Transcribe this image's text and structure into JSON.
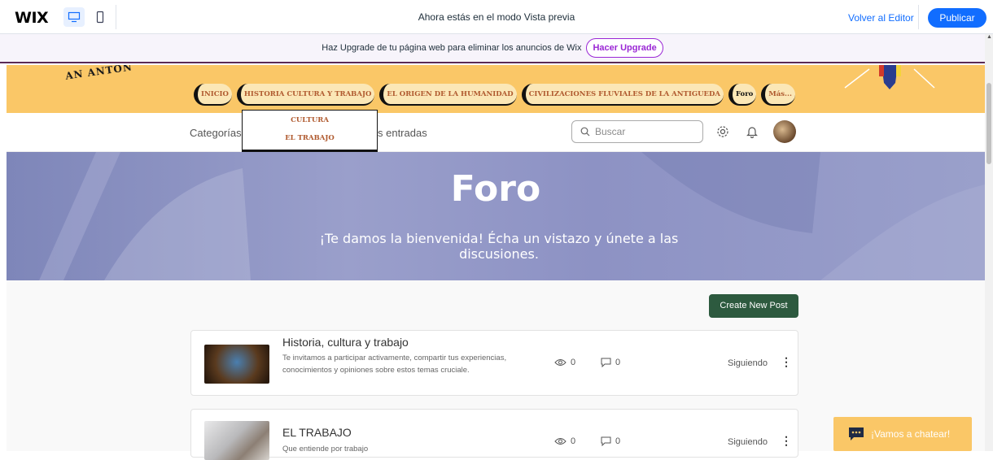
{
  "wix_bar": {
    "logo": "WIX",
    "preview_text": "Ahora estás en el modo Vista previa",
    "back_to_editor": "Volver al Editor",
    "publish": "Publicar",
    "accent_color": "#116dff"
  },
  "upgrade_banner": {
    "text": "Haz Upgrade de tu página web para eliminar los anuncios de Wix",
    "button": "Hacer Upgrade"
  },
  "site_header": {
    "logo_text": "AN ANTON",
    "nav": [
      "INICIO",
      "HISTORIA CULTURA Y TRABAJO",
      "EL ORIGEN DE LA HUMANIDAD",
      "CIVILIZACIONES FLUVIALES DE LA ANTIGUEDA",
      "Foro",
      "Más..."
    ],
    "dropdown": [
      "CULTURA",
      "EL TRABAJO"
    ],
    "bg_color": "#fac767"
  },
  "forum_bar": {
    "categories": "Categorías",
    "entries_partial": "s entradas",
    "search_placeholder": "Buscar"
  },
  "hero": {
    "title": "Foro",
    "subtitle": "¡Te damos la bienvenida! Écha un vistazo y únete a las discusiones."
  },
  "create_button": "Create New Post",
  "posts": [
    {
      "title": "Historia, cultura y trabajo",
      "description": "Te invitamos a participar activamente, compartir tus experiencias, conocimientos y opiniones sobre estos temas cruciale.",
      "views": "0",
      "comments": "0",
      "following": "Siguiendo"
    },
    {
      "title": "EL TRABAJO",
      "description": "Que entiende por trabajo",
      "views": "0",
      "comments": "0",
      "following": "Siguiendo"
    }
  ],
  "chat": {
    "label": "¡Vamos a chatear!"
  }
}
